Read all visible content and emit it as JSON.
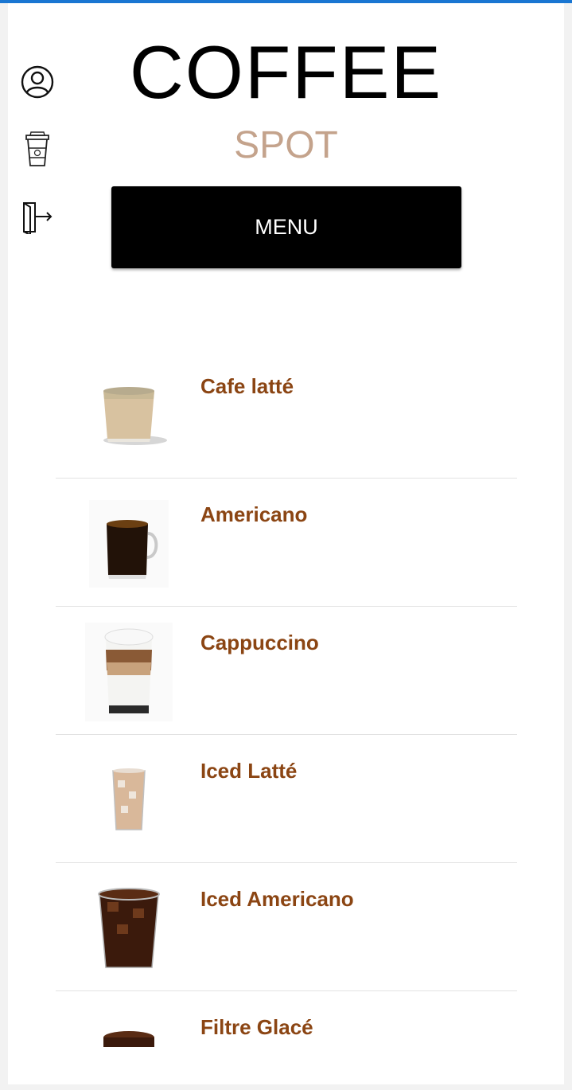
{
  "header": {
    "title": "COFFEE",
    "subtitle": "SPOT",
    "menu_label": "MENU"
  },
  "sidebar": {
    "icons": [
      "user-circle-icon",
      "coffee-cup-icon",
      "logout-icon"
    ]
  },
  "menu": {
    "items": [
      {
        "name": "Cafe latté",
        "icon": "cafe-latte-image"
      },
      {
        "name": "Americano",
        "icon": "americano-image"
      },
      {
        "name": "Cappuccino",
        "icon": "cappuccino-image"
      },
      {
        "name": "Iced Latté",
        "icon": "iced-latte-image"
      },
      {
        "name": "Iced Americano",
        "icon": "iced-americano-image"
      },
      {
        "name": "Filtre Glacé",
        "icon": "filtre-glace-image"
      }
    ]
  },
  "colors": {
    "accent_bar": "#1976d2",
    "subtitle": "#c4a38c",
    "item_name": "#8b4513",
    "button_bg": "#000000"
  }
}
